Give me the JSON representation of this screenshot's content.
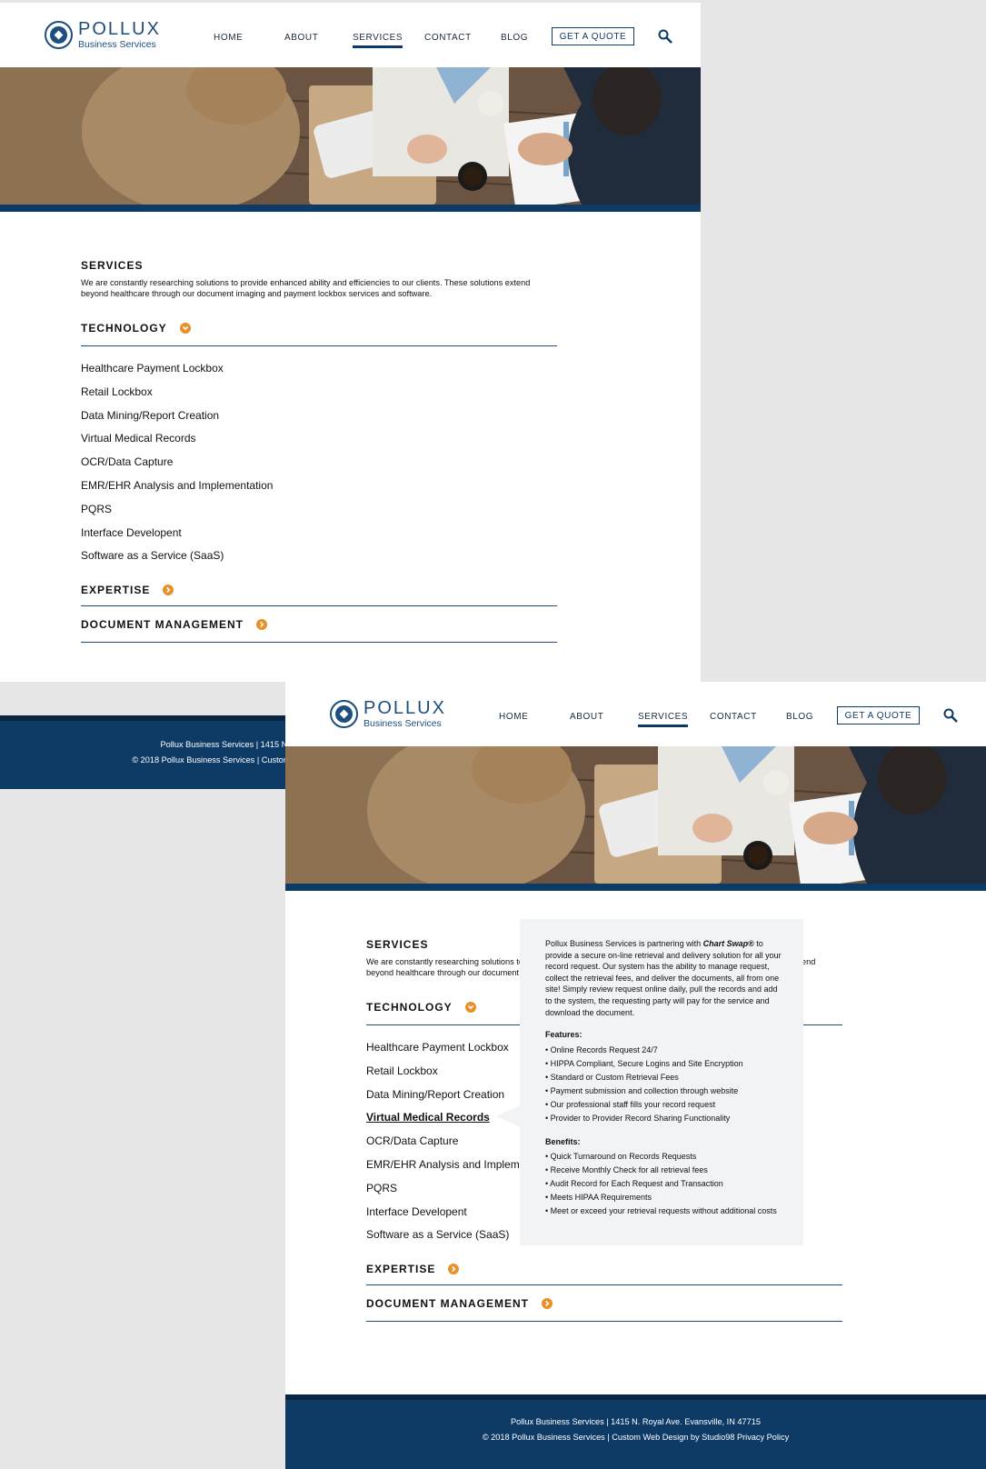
{
  "brand": {
    "name": "POLLUX",
    "subtitle": "Business Services"
  },
  "nav": {
    "items": [
      "HOME",
      "ABOUT",
      "SERVICES",
      "CONTACT",
      "BLOG"
    ],
    "active": "SERVICES",
    "quote_label": "GET A QUOTE"
  },
  "services": {
    "title": "SERVICES",
    "intro_line1": "We are constantly researching solutions to provide enhanced ability and efficiencies to our clients. These solutions extend",
    "intro_line2": "beyond healthcare through our document imaging and payment lockbox services and software.",
    "sections": [
      {
        "title": "TECHNOLOGY",
        "expanded": true,
        "items": [
          "Healthcare Payment Lockbox",
          "Retail Lockbox",
          "Data Mining/Report Creation",
          "Virtual Medical Records",
          "OCR/Data  Capture",
          "EMR/EHR Analysis and Implementation",
          "PQRS",
          "Interface Developent",
          "Software as a Service (SaaS)"
        ]
      },
      {
        "title": "EXPERTISE",
        "expanded": false
      },
      {
        "title": "DOCUMENT MANAGEMENT",
        "expanded": false
      }
    ]
  },
  "footer": {
    "line1": "Pollux Business Services | 1415 N. Royal Ave. Evansville, IN 47715",
    "line2": "© 2018 Pollux Business Services | Custom Web Design by Studio98 Privacy Policy"
  },
  "popup": {
    "intro_pre": "Pollux Business Services is partnering with",
    "intro_brand": "Chart Swap®",
    "intro_post": "to provide a secure on-line retrieval and delivery solution for all your record request. Our system has the ability to manage request, collect the retrieval fees, and deliver the documents, all from one site! Simply review request online daily, pull the records and add to the system, the requesting party will pay for the service and download the document.",
    "features_title": "Features:",
    "features": [
      "Online Records Request 24/7",
      "HIPPA Compliant, Secure Logins and Site Encryption",
      "Standard or Custom Retrieval Fees",
      "Payment submission and collection through website",
      "Our professional staff fills your record request",
      "Provider to Provider Record Sharing Functionality"
    ],
    "benefits_title": "Benefits:",
    "benefits": [
      "Quick Turnaround on Records Requests",
      "Receive Monthly Check for all retrieval fees",
      "Audit Record for Each Request and Transaction",
      "Meets HIPAA Requirements",
      "Meet or exceed your retrieval requests without additional costs"
    ]
  },
  "popup_anchor_item": "Virtual Medical Records",
  "colors": {
    "navy": "#0e3a66",
    "accent": "#e8912a",
    "rule": "#1d4e7e",
    "popup_bg": "#f2f3f5"
  },
  "icons": [
    "logo-emblem",
    "search-icon",
    "chevron-down-icon",
    "chevron-right-icon"
  ]
}
